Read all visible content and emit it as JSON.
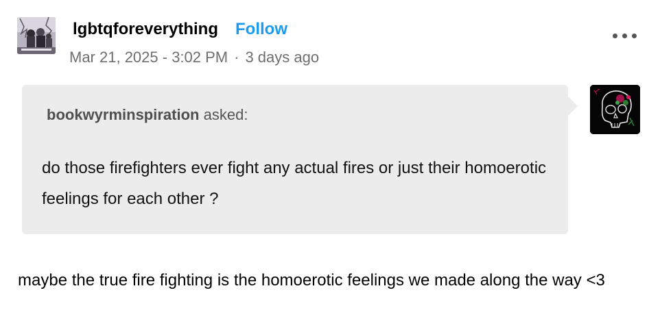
{
  "post": {
    "username": "lgbtqforeverything",
    "follow_label": "Follow",
    "date": "Mar 21, 2025 - 3:02 PM",
    "separator": "·",
    "relative_time": "3 days ago",
    "more_icon": "ellipsis-icon"
  },
  "ask": {
    "asker": "bookwyrminspiration",
    "asked_label": "asked:",
    "question": "do those firefighters ever fight any actual fires or just their homoerotic feelings for each other ?"
  },
  "answer": {
    "text": "maybe the true fire fighting is the homoerotic feelings we made along the way <3"
  },
  "colors": {
    "follow": "#1a9bf0",
    "meta": "#6e6e6e",
    "ask_background": "#ececec"
  }
}
